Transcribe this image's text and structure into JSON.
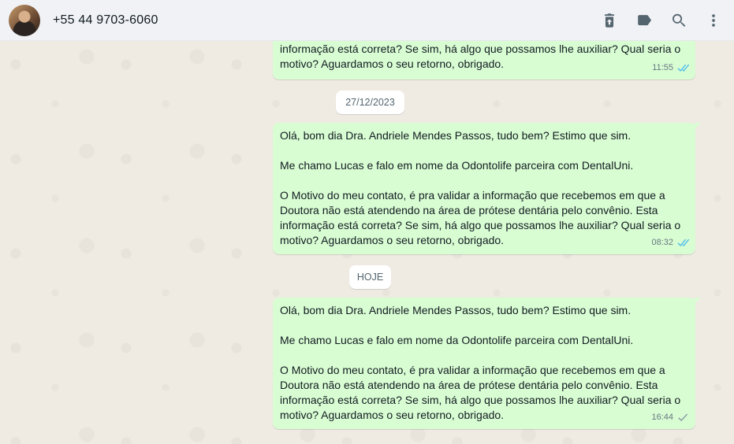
{
  "header": {
    "contact_name": "+55 44 9703-6060",
    "icons": [
      "delete-icon",
      "label-icon",
      "search-icon",
      "menu-icon"
    ]
  },
  "messages": {
    "partial": {
      "lines": "informação está correta? Se sim, há algo que possamos lhe auxiliar? Qual seria o\nmotivo? Aguardamos o seu retorno, obrigado.",
      "time": "11:55",
      "status": "read"
    },
    "date1": "27/12/2023",
    "msg1": {
      "text": "Olá, bom dia Dra. Andriele Mendes Passos, tudo bem? Estimo que sim.\n\nMe chamo Lucas e falo em nome da Odontolife parceira com DentalUni.\n\nO Motivo do meu contato, é pra validar a informação que recebemos em que a\nDoutora não está atendendo na área de prótese dentária pelo convênio. Esta\ninformação está correta? Se sim, há algo que possamos lhe auxiliar? Qual seria o\nmotivo? Aguardamos o seu retorno, obrigado.",
      "time": "08:32",
      "status": "read"
    },
    "date2": "HOJE",
    "msg2": {
      "text": "Olá, bom dia Dra. Andriele Mendes Passos, tudo bem? Estimo que sim.\n\nMe chamo Lucas e falo em nome da Odontolife parceira com DentalUni.\n\nO Motivo do meu contato, é pra validar a informação que recebemos em que a\nDoutora não está atendendo na área de prótese dentária pelo convênio. Esta\ninformação está correta? Se sim, há algo que possamos lhe auxiliar? Qual seria o\nmotivo? Aguardamos o seu retorno, obrigado.",
      "time": "16:44",
      "status": "sent"
    }
  },
  "colors": {
    "bubble_out": "#d9fdd3",
    "read_tick": "#53bdeb",
    "sent_tick": "#8696a0",
    "header_bg": "#f0f2f5",
    "wallpaper": "#efeae2"
  }
}
